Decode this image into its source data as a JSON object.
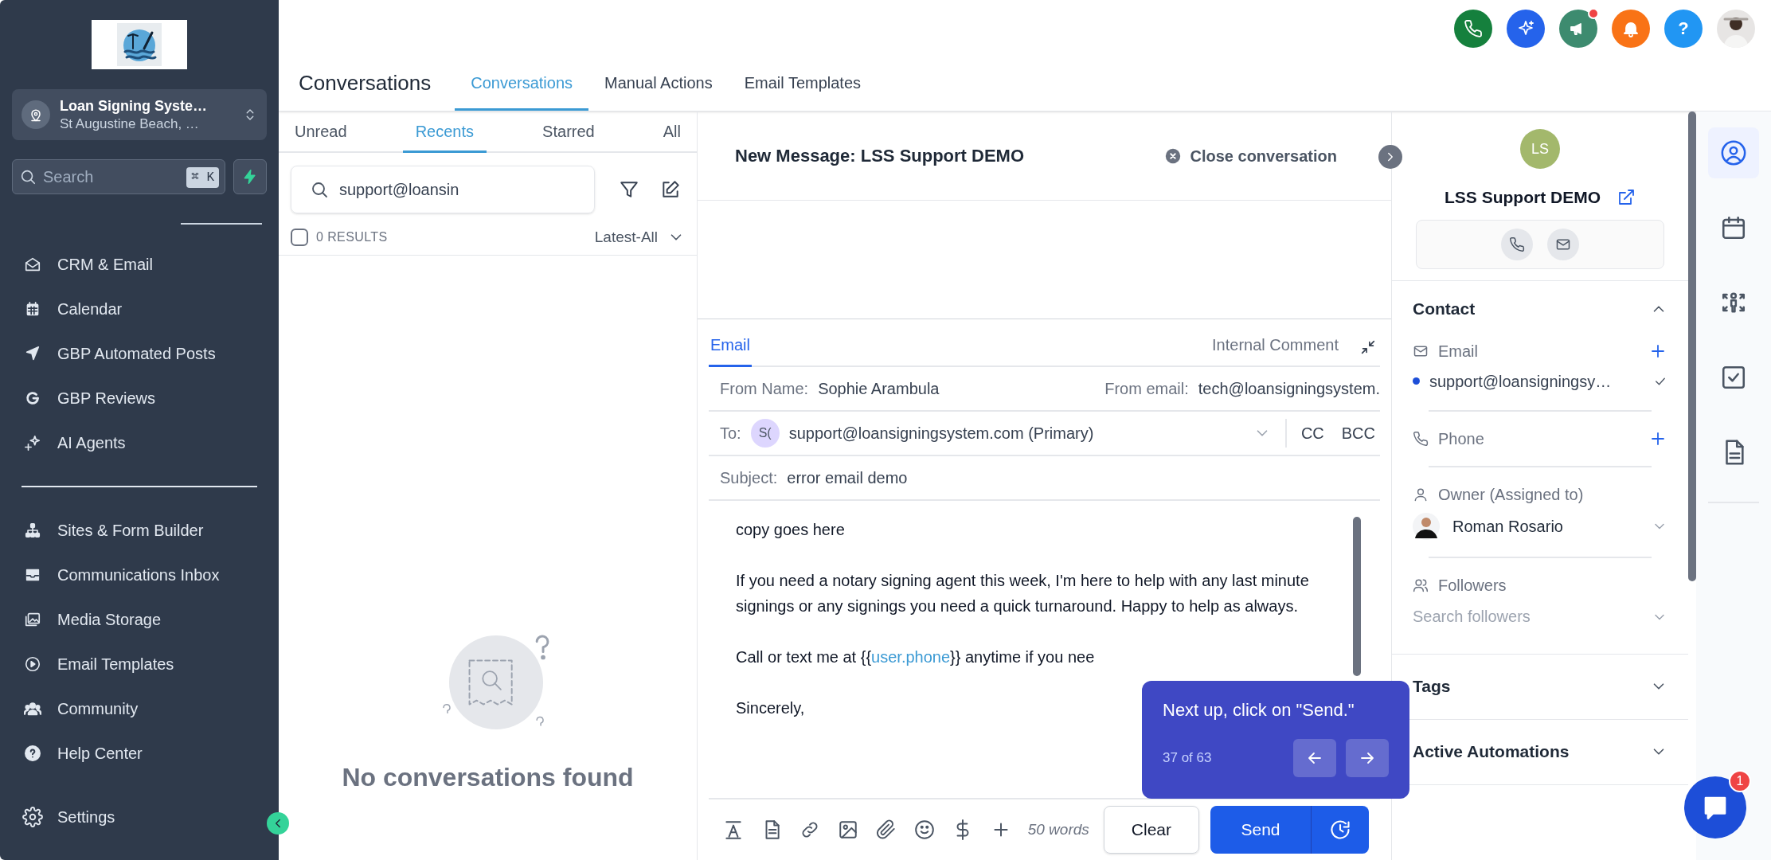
{
  "sidebar": {
    "account": {
      "name": "Loan Signing Syste…",
      "location": "St Augustine Beach, …"
    },
    "search": {
      "placeholder": "Search",
      "shortcut": "⌘ K"
    },
    "groups": [
      {
        "items": [
          {
            "label": "CRM & Email"
          },
          {
            "label": "Calendar"
          },
          {
            "label": "GBP Automated Posts"
          },
          {
            "label": "GBP Reviews"
          },
          {
            "label": "AI Agents"
          }
        ]
      },
      {
        "items": [
          {
            "label": "Sites & Form Builder"
          },
          {
            "label": "Communications Inbox"
          },
          {
            "label": "Media Storage"
          },
          {
            "label": "Email Templates"
          },
          {
            "label": "Community"
          },
          {
            "label": "Help Center"
          }
        ]
      }
    ],
    "settings": "Settings"
  },
  "header": {
    "title": "Conversations",
    "help": "?",
    "tabs": [
      {
        "label": "Conversations",
        "selected": true
      },
      {
        "label": "Manual Actions",
        "selected": false
      },
      {
        "label": "Email Templates",
        "selected": false
      }
    ]
  },
  "conversation_list": {
    "filters": [
      {
        "label": "Unread",
        "selected": false
      },
      {
        "label": "Recents",
        "selected": true
      },
      {
        "label": "Starred",
        "selected": false
      },
      {
        "label": "All",
        "selected": false
      }
    ],
    "search": {
      "value": "support@loansin"
    },
    "select_all": {
      "checked": false
    },
    "results": "0 RESULTS",
    "sort": "Latest-All",
    "empty_message": "No conversations found"
  },
  "message": {
    "title": "New Message: LSS Support DEMO",
    "close": "Close conversation",
    "compose": {
      "tabs": [
        {
          "label": "Email",
          "selected": true
        },
        {
          "label": "Internal Comment",
          "selected": false
        }
      ],
      "from_name_label": "From Name:",
      "from_name": "Sophie Arambula",
      "from_email_label": "From email:",
      "from_email": "tech@loansigningsystem.",
      "to_label": "To:",
      "to_avatar": "S(",
      "to": "support@loansigningsystem.com (Primary)",
      "cc": "CC",
      "bcc": "BCC",
      "subject_label": "Subject:",
      "subject": "error email demo",
      "body": [
        [
          {
            "text": "copy goes here"
          }
        ],
        [
          {
            "text": "If you need a notary signing agent this week, I'm here to help with any last minute signings or any signings you need a quick turnaround. Happy to help as always."
          }
        ],
        [
          {
            "text": "Call or text me at {{"
          },
          {
            "text": "user.phone",
            "kind": "variable"
          },
          {
            "text": "}} anytime if you nee"
          }
        ],
        [
          {
            "text": "Sincerely,"
          }
        ]
      ],
      "word_count": "50 words",
      "clear": "Clear",
      "send": "Send"
    }
  },
  "tooltip": {
    "text": "Next up, click on \"Send.\"",
    "step": "37 of 63"
  },
  "contact_panel": {
    "avatar": "LS",
    "name": "LSS Support DEMO",
    "contact": {
      "title": "Contact",
      "expanded": true,
      "email_label": "Email",
      "email": "support@loansigningsy…",
      "phone_label": "Phone",
      "owner_label": "Owner (Assigned to)",
      "owner": "Roman Rosario",
      "followers_label": "Followers",
      "followers_placeholder": "Search followers"
    },
    "sections": [
      {
        "title": "Tags",
        "expanded": false
      },
      {
        "title": "Active Automations",
        "expanded": false
      }
    ]
  },
  "rail": [
    {
      "selected": true
    },
    {
      "selected": false
    },
    {
      "selected": false
    },
    {
      "selected": false
    },
    {
      "selected": false
    }
  ],
  "chat": {
    "badge": "1"
  }
}
